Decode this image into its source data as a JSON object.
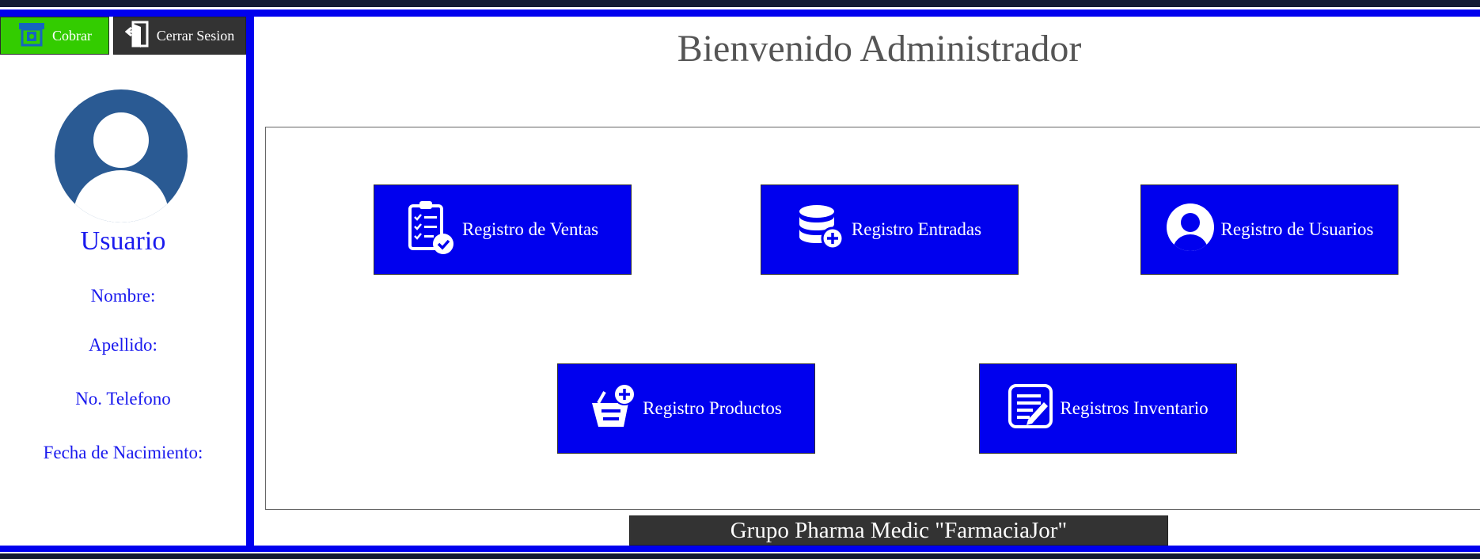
{
  "header": {
    "cobrar_label": "Cobrar",
    "cerrar_label": "Cerrar Sesion",
    "cobrar_icon": "cash-register-icon",
    "cerrar_icon": "logout-door-icon"
  },
  "sidebar": {
    "avatar_icon": "user-avatar-icon",
    "usuario": "Usuario",
    "nombre": "Nombre:",
    "apellido": "Apellido:",
    "telefono": "No. Telefono",
    "fecha": "Fecha de Nacimiento:"
  },
  "main": {
    "title": "Bienvenido Administrador",
    "tiles": [
      {
        "label": "Registro de Ventas",
        "icon": "clipboard-check-icon"
      },
      {
        "label": "Registro Entradas",
        "icon": "database-add-icon"
      },
      {
        "label": "Registro de Usuarios",
        "icon": "user-circle-icon"
      },
      {
        "label": "Registro Productos",
        "icon": "basket-add-icon"
      },
      {
        "label": "Registros Inventario",
        "icon": "edit-document-icon"
      }
    ]
  },
  "footer": {
    "text": "Grupo Pharma Medic \"FarmaciaJor\""
  },
  "colors": {
    "accent_blue": "#0000ee",
    "cobrar_green": "#33cc00",
    "dark_button": "#333333",
    "avatar_blue": "#2a5a93",
    "title_gray": "#555555"
  }
}
